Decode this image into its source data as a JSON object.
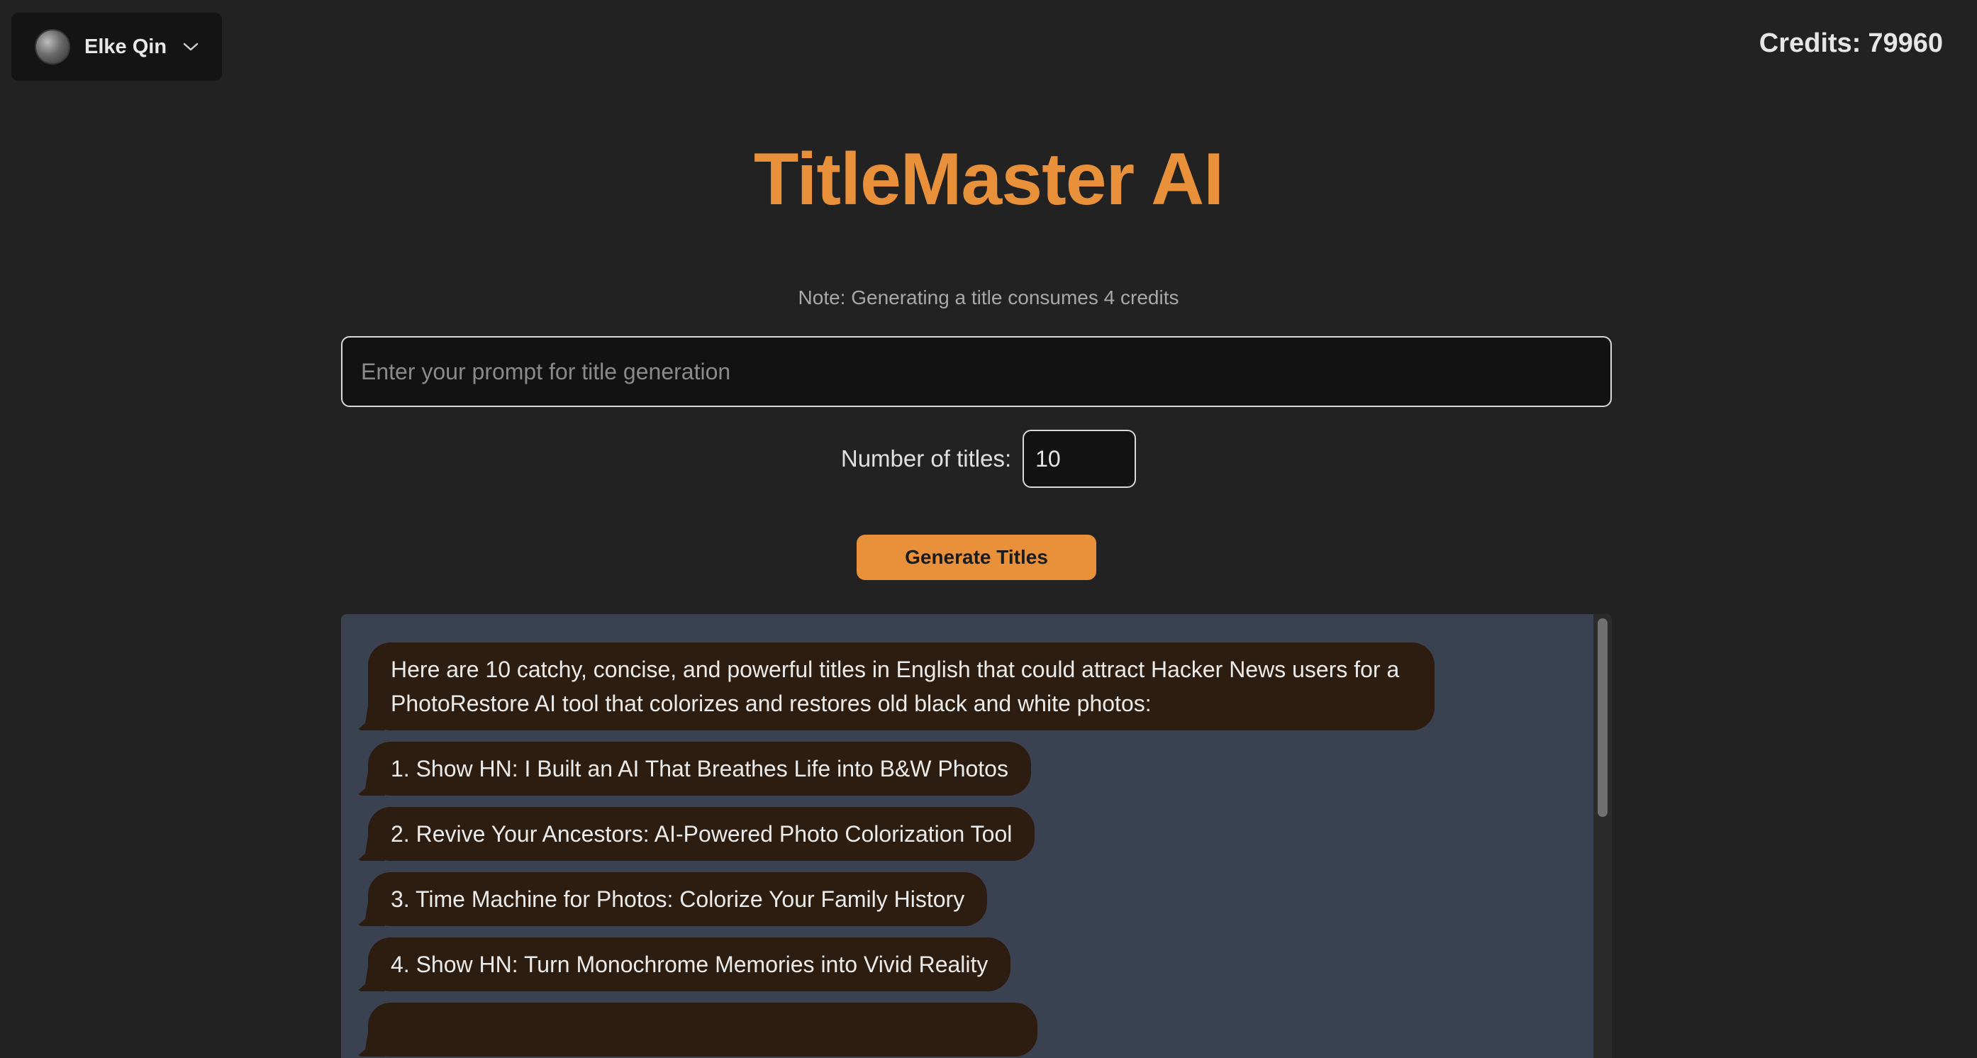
{
  "user": {
    "name": "Elke Qin"
  },
  "credits": {
    "label": "Credits:",
    "value": "79960"
  },
  "title": "TitleMaster AI",
  "note": "Note: Generating a title consumes 4 credits",
  "prompt": {
    "placeholder": "Enter your prompt for title generation",
    "value": ""
  },
  "count": {
    "label": "Number of titles:",
    "value": "10"
  },
  "generate_button": "Generate Titles",
  "results": {
    "messages": [
      "Here are 10 catchy, concise, and powerful titles in English that could attract Hacker News users for a PhotoRestore AI tool that colorizes and restores old black and white photos:",
      "1. Show HN: I Built an AI That Breathes Life into B&W Photos",
      "2. Revive Your Ancestors: AI-Powered Photo Colorization Tool",
      "3. Time Machine for Photos: Colorize Your Family History",
      "4. Show HN: Turn Monochrome Memories into Vivid Reality",
      ""
    ]
  },
  "colors": {
    "accent": "#e8913a",
    "background": "#222222",
    "panel": "#3a4150",
    "bubble": "#2c1d10"
  },
  "icons": {
    "user_menu": "chevron-down-icon"
  }
}
